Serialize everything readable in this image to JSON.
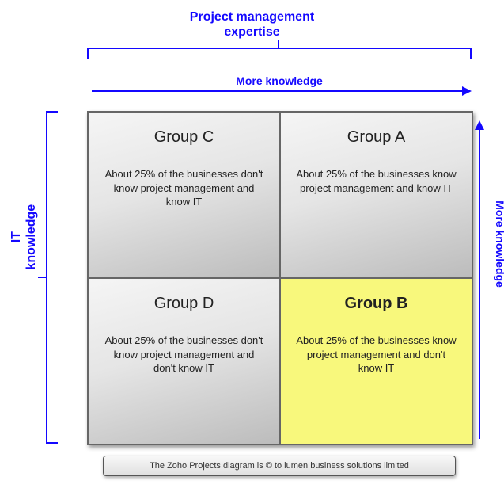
{
  "axes": {
    "top_title_line1": "Project management",
    "top_title_line2": "expertise",
    "top_sublabel": "More knowledge",
    "left_title_line1": "IT",
    "left_title_line2": "knowledge",
    "right_sublabel": "More knowledge"
  },
  "quadrants": {
    "top_left": {
      "title": "Group C",
      "desc": "About 25% of the businesses don't know project management and know IT"
    },
    "top_right": {
      "title": "Group A",
      "desc": "About 25% of the businesses know project management and know IT"
    },
    "bottom_left": {
      "title": "Group D",
      "desc": "About 25% of the businesses don't know project management and don't know IT"
    },
    "bottom_right": {
      "title": "Group B",
      "desc": "About 25% of the businesses know project management and don't know IT",
      "highlight": true
    }
  },
  "caption": "The Zoho Projects diagram is © to lumen business solutions limited",
  "chart_data": {
    "type": "table",
    "x_axis": "Project management expertise",
    "y_axis": "IT knowledge",
    "x_direction": "More knowledge (right)",
    "y_direction": "More knowledge (up)",
    "cells": [
      {
        "row": "high IT knowledge",
        "col": "low PM expertise",
        "group": "Group C",
        "share_pct": 25,
        "note": "don't know project management and know IT"
      },
      {
        "row": "high IT knowledge",
        "col": "high PM expertise",
        "group": "Group A",
        "share_pct": 25,
        "note": "know project management and know IT"
      },
      {
        "row": "low IT knowledge",
        "col": "low PM expertise",
        "group": "Group D",
        "share_pct": 25,
        "note": "don't know project management and don't know IT"
      },
      {
        "row": "low IT knowledge",
        "col": "high PM expertise",
        "group": "Group B",
        "share_pct": 25,
        "note": "know project management and don't know IT",
        "highlighted": true
      }
    ]
  }
}
